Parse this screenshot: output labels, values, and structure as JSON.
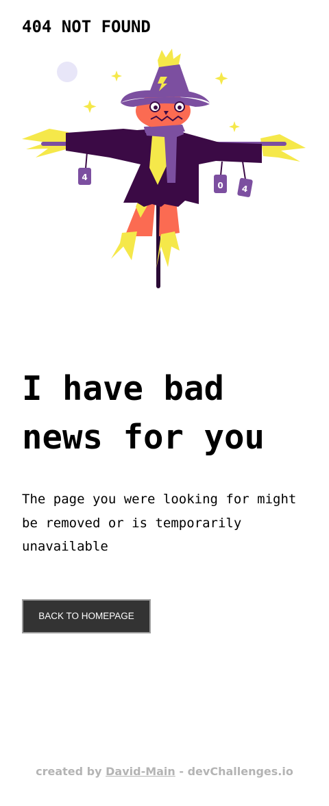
{
  "header": {
    "title": "404 NOT FOUND"
  },
  "illustration": {
    "cans": [
      "4",
      "0",
      "4"
    ],
    "colors": {
      "coat": "#3b0a45",
      "hat": "#7c4fa0",
      "face": "#fb6b52",
      "straw": "#f5e84a",
      "pole": "#2a0a35",
      "moon": "#e8e6f8"
    }
  },
  "main": {
    "headline": "I have bad news for you",
    "description": "The page you were looking for might be removed or is temporarily unavailable",
    "button_label": "BACK TO HOMEPAGE"
  },
  "footer": {
    "prefix": "created by ",
    "author": "David-Main",
    "suffix": " - devChallenges.io"
  }
}
